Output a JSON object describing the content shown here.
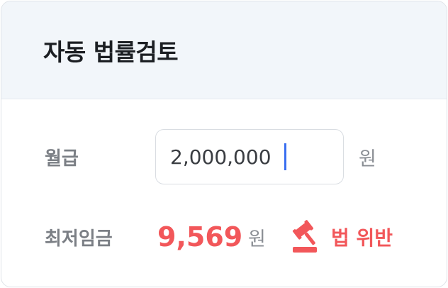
{
  "header": {
    "title": "자동 법률검토"
  },
  "salary": {
    "label": "월급",
    "value": "2,000,000",
    "unit": "원"
  },
  "minimum_wage": {
    "label": "최저임금",
    "value": "9,569",
    "unit": "원",
    "status_icon": "gavel-icon",
    "status_text": "법 위반",
    "status_color": "#f2575a"
  },
  "colors": {
    "header_background": "#f2f6fa",
    "accent_caret": "#3a6ff0",
    "warning": "#f2575a"
  }
}
